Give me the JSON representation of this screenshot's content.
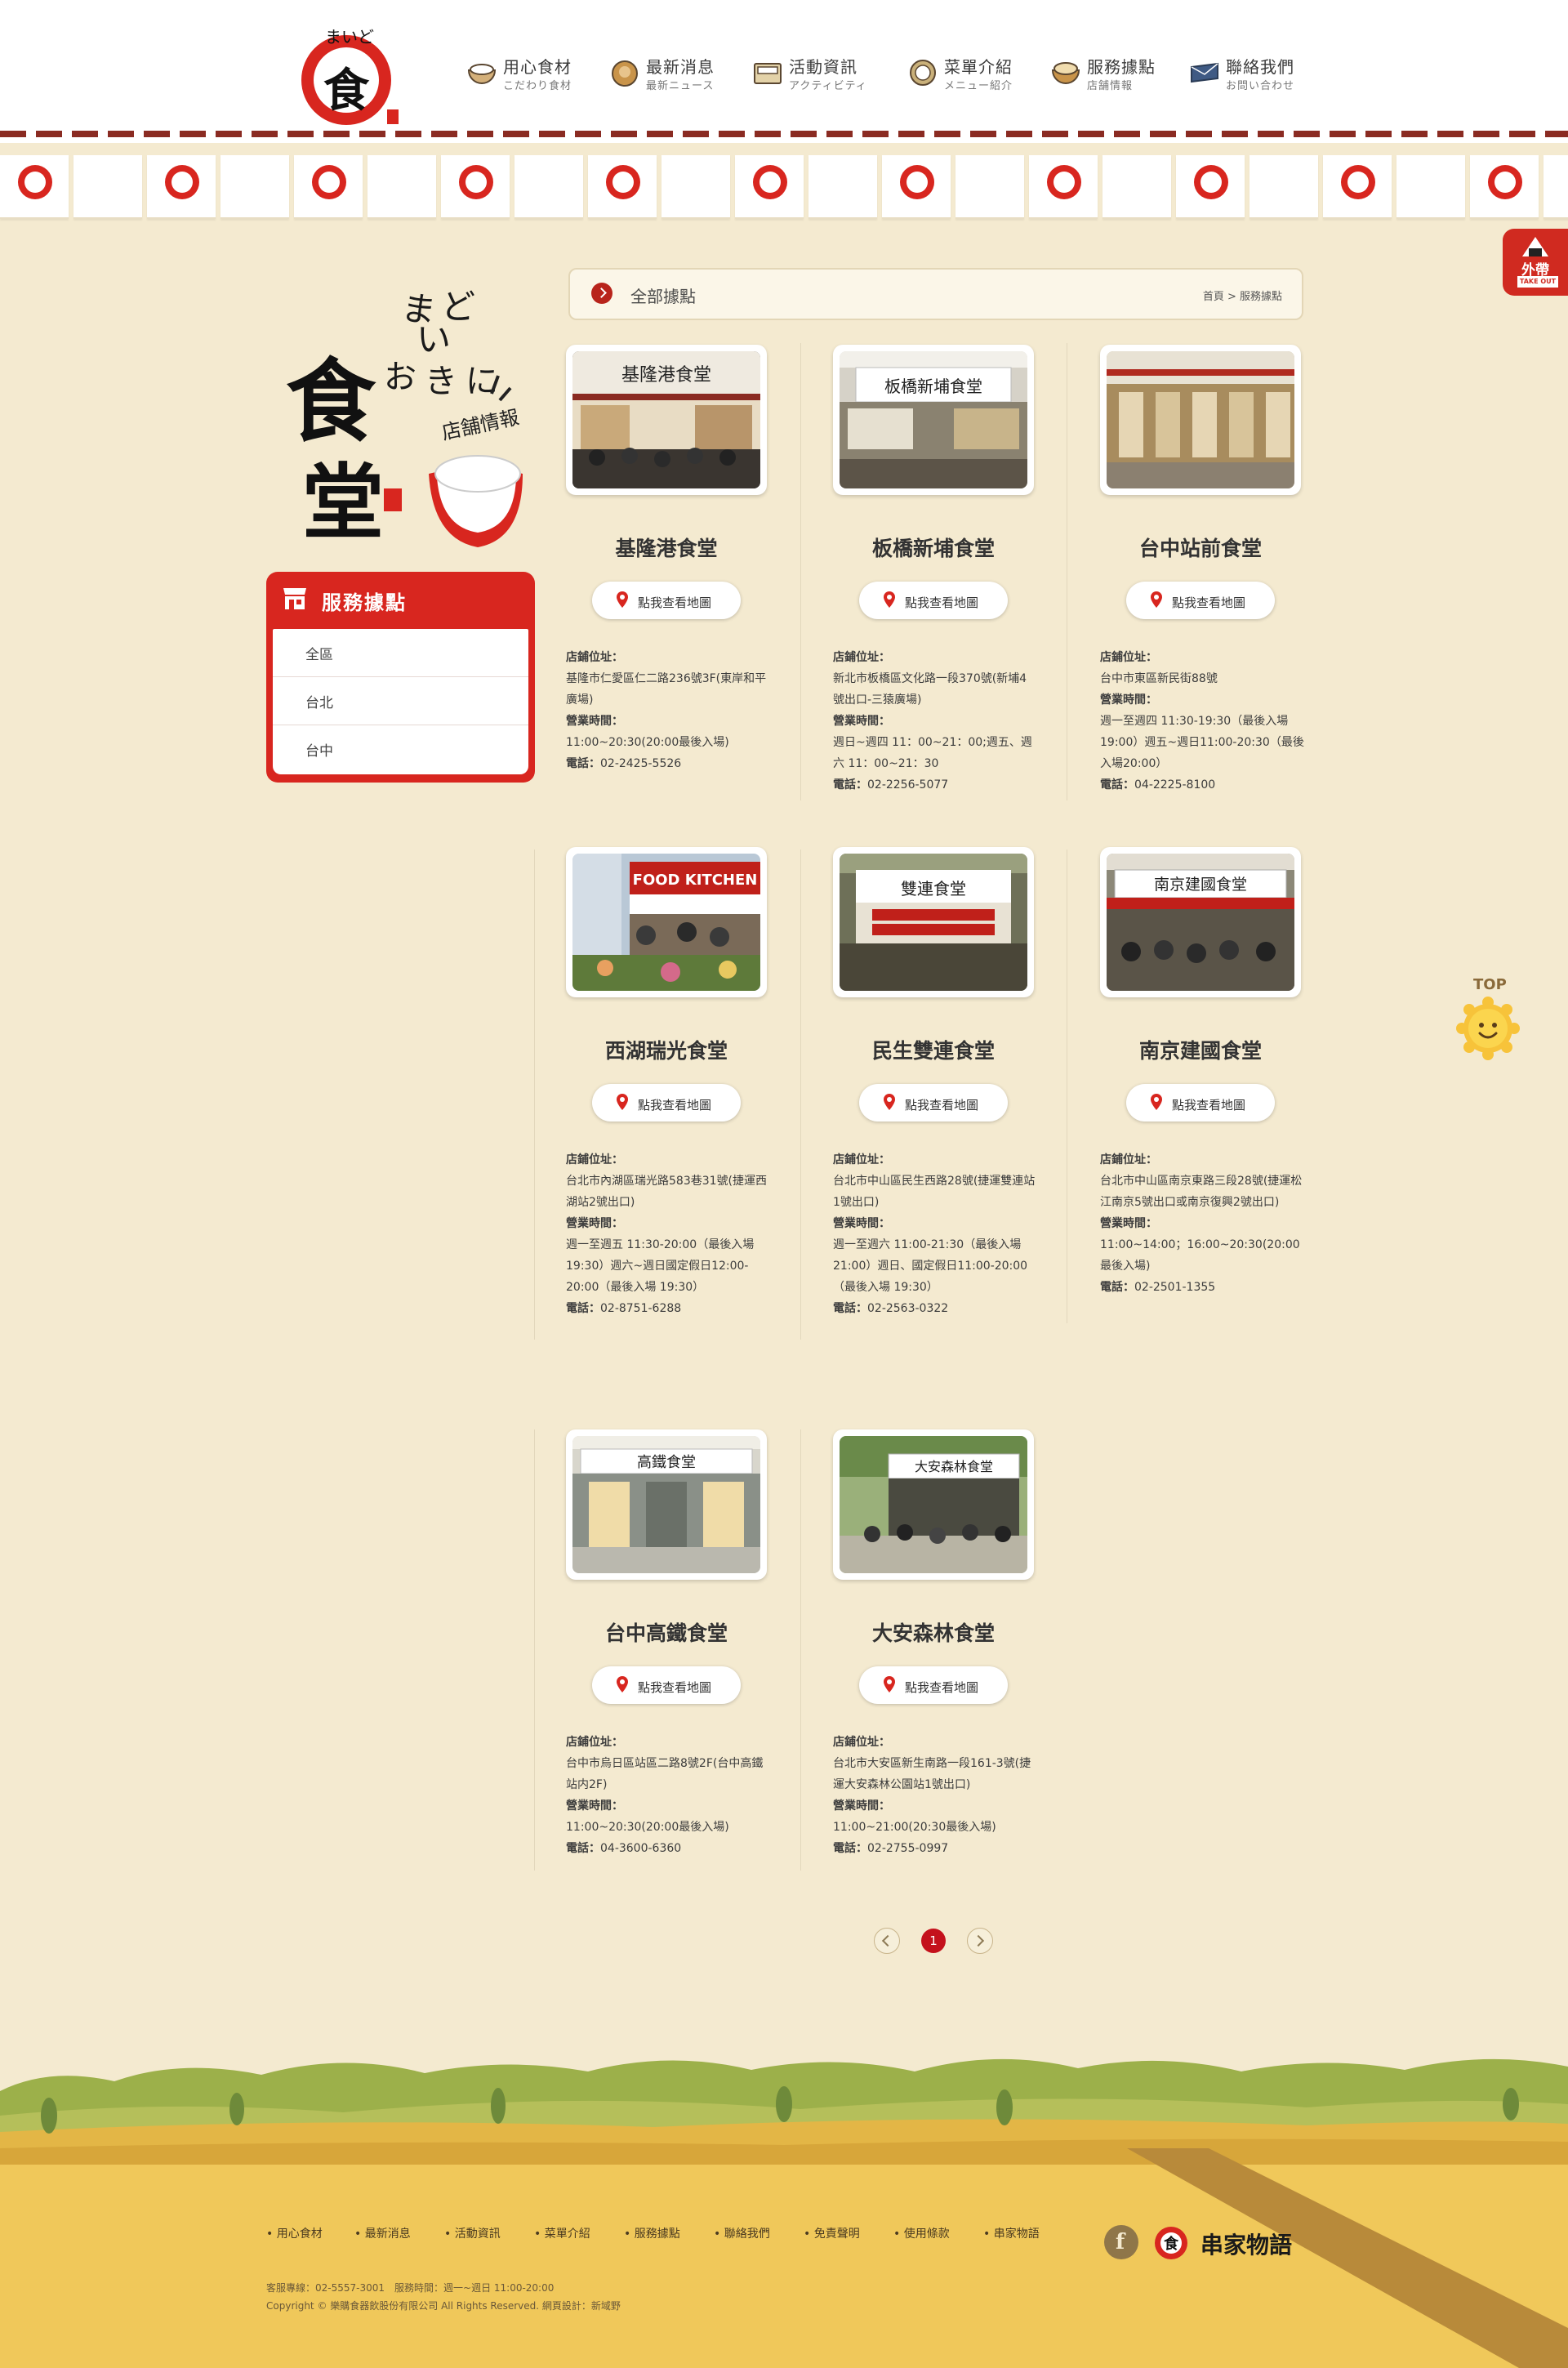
{
  "header": {
    "logo_alt": "まいどおおきに食堂",
    "nav": [
      {
        "zh": "用心食材",
        "jp": "こだわり食材",
        "icon": "rice-bowl-icon"
      },
      {
        "zh": "最新消息",
        "jp": "最新ニュース",
        "icon": "bun-icon"
      },
      {
        "zh": "活動資訊",
        "jp": "アクティビティ",
        "icon": "box-icon"
      },
      {
        "zh": "菜單介紹",
        "jp": "メニュー紹介",
        "icon": "bowl-icon"
      },
      {
        "zh": "服務據點",
        "jp": "店舗情報",
        "icon": "donburi-icon"
      },
      {
        "zh": "聯絡我們",
        "jp": "お問い合わせ",
        "icon": "letter-icon"
      }
    ]
  },
  "float": {
    "takeout": "外帶",
    "takeout_sub": "TAKE OUT",
    "top": "TOP"
  },
  "sidebar": {
    "art_title": "まいどおおきに食堂",
    "art_sub": "店舗情報",
    "title": "服務據點",
    "items": [
      "全區",
      "台北",
      "台中"
    ]
  },
  "main": {
    "title": "全部據點",
    "breadcrumb": "首頁 > 服務據點",
    "map_label": "點我查看地圖",
    "addr_label": "店鋪位址：",
    "hours_label": "營業時間：",
    "tel_label": "電話：",
    "stores": [
      {
        "name": "基隆港食堂",
        "addr": "基隆市仁愛區仁二路236號3F(東岸和平廣場)",
        "hours": "11:00~20:30(20:00最後入場)",
        "tel": "02-2425-5526",
        "sign": "基隆港食堂"
      },
      {
        "name": "板橋新埔食堂",
        "addr": "新北市板橋區文化路一段370號(新埔4號出口-三猿廣場)",
        "hours": "週日~週四 11：00~21：00;週五、週六 11：00~21：30",
        "tel": "02-2256-5077",
        "sign": "板橋新埔食堂"
      },
      {
        "name": "台中站前食堂",
        "addr": "台中市東區新民街88號",
        "hours": "週一至週四 11:30-19:30（最後入場19:00）週五~週日11:00-20:30（最後入場20:00）",
        "tel": "04-2225-8100",
        "sign": ""
      },
      {
        "name": "西湖瑞光食堂",
        "addr": "台北市內湖區瑞光路583巷31號(捷運西湖站2號出口)",
        "hours": "週一至週五 11:30-20:00（最後入場19:30）週六~週日國定假日12:00-20:00（最後入場 19:30）",
        "tel": "02-8751-6288",
        "sign": "FOOD KITCHEN"
      },
      {
        "name": "民生雙連食堂",
        "addr": "台北市中山區民生西路28號(捷運雙連站1號出口)",
        "hours": "週一至週六 11:00-21:30（最後入場21:00）週日、國定假日11:00-20:00（最後入場 19:30）",
        "tel": "02-2563-0322",
        "sign": "雙連食堂"
      },
      {
        "name": "南京建國食堂",
        "addr": "台北市中山區南京東路三段28號(捷運松江南京5號出口或南京復興2號出口)",
        "hours": "11:00~14:00；16:00~20:30(20:00最後入場)",
        "tel": "02-2501-1355",
        "sign": "南京建國食堂"
      },
      {
        "name": "台中高鐵食堂",
        "addr": "台中市烏日區站區二路8號2F(台中高鐵站内2F)",
        "hours": "11:00~20:30(20:00最後入場)",
        "tel": "04-3600-6360",
        "sign": "高鐵食堂"
      },
      {
        "name": "大安森林食堂",
        "addr": "台北市大安區新生南路一段161-3號(捷運大安森林公園站1號出口)",
        "hours": "11:00~21:00(20:30最後入場)",
        "tel": "02-2755-0997",
        "sign": "大安森林食堂"
      }
    ]
  },
  "pager": {
    "current": "1"
  },
  "footer": {
    "links": [
      "用心食材",
      "最新消息",
      "活動資訊",
      "菜單介紹",
      "服務據點",
      "聯絡我們",
      "免責聲明",
      "使用條款",
      "串家物語"
    ],
    "service": "客服專線：02-5557-3001　服務時間：週一~週日 11:00-20:00",
    "copyright": "Copyright © 樂購食器飲股份有限公司 All Rights Reserved. 網頁設計：新域野",
    "brand": "串家物語"
  },
  "colors": {
    "accent": "#d8261f",
    "background": "#f4ead0"
  }
}
